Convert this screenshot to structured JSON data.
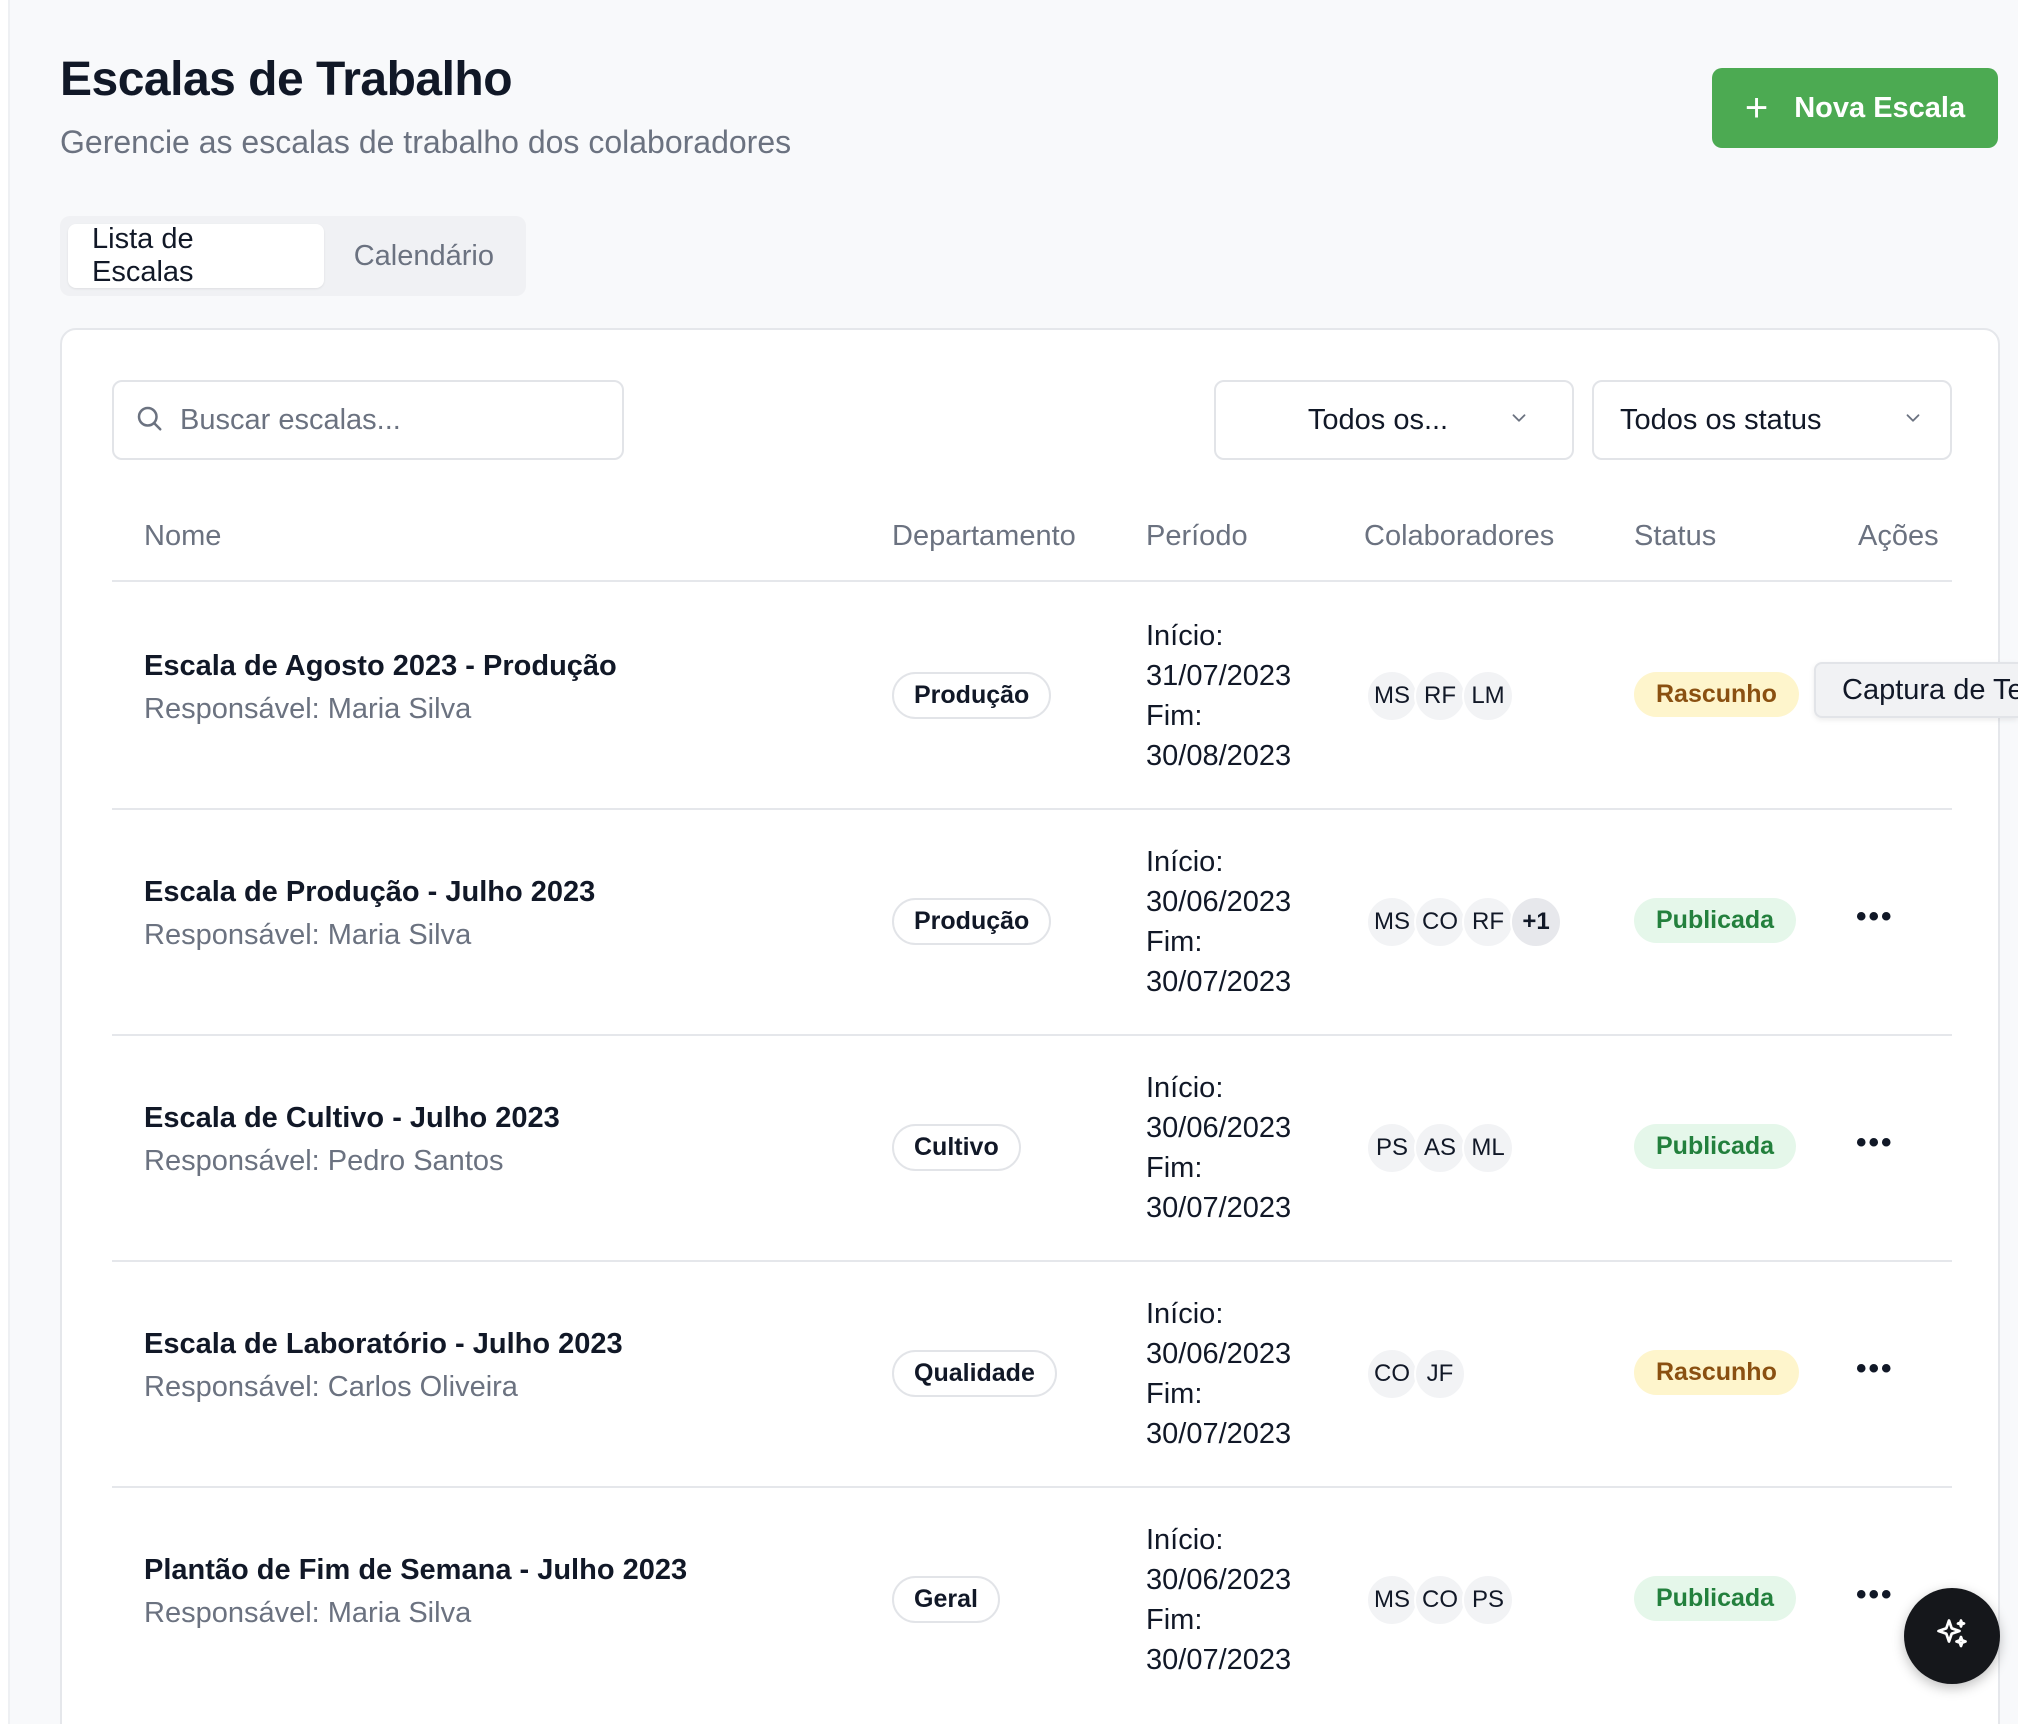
{
  "header": {
    "title": "Escalas de Trabalho",
    "subtitle": "Gerencie as escalas de trabalho dos colaboradores",
    "new_button_label": "Nova Escala",
    "new_button_color": "#4caa52"
  },
  "tabs": [
    {
      "label": "Lista de Escalas",
      "active": true
    },
    {
      "label": "Calendário",
      "active": false
    }
  ],
  "filters": {
    "search_placeholder": "Buscar escalas...",
    "search_value": "",
    "department_selected": "Todos os...",
    "status_selected": "Todos os status"
  },
  "table": {
    "headers": {
      "name": "Nome",
      "department": "Departamento",
      "period": "Período",
      "collaborators": "Colaboradores",
      "status": "Status",
      "actions": "Ações"
    },
    "rows": [
      {
        "name": "Escala de Agosto 2023 - Produção",
        "responsible": "Responsável: Maria Silva",
        "department": "Produção",
        "start_label": "Início:",
        "start": "31/07/2023",
        "end_label": "Fim:",
        "end": "30/08/2023",
        "collaborators": [
          "MS",
          "RF",
          "LM"
        ],
        "extra": "",
        "status": "Rascunho",
        "status_type": "draft"
      },
      {
        "name": "Escala de Produção - Julho 2023",
        "responsible": "Responsável: Maria Silva",
        "department": "Produção",
        "start_label": "Início:",
        "start": "30/06/2023",
        "end_label": "Fim:",
        "end": "30/07/2023",
        "collaborators": [
          "MS",
          "CO",
          "RF"
        ],
        "extra": "+1",
        "status": "Publicada",
        "status_type": "published"
      },
      {
        "name": "Escala de Cultivo - Julho 2023",
        "responsible": "Responsável: Pedro Santos",
        "department": "Cultivo",
        "start_label": "Início:",
        "start": "30/06/2023",
        "end_label": "Fim:",
        "end": "30/07/2023",
        "collaborators": [
          "PS",
          "AS",
          "ML"
        ],
        "extra": "",
        "status": "Publicada",
        "status_type": "published"
      },
      {
        "name": "Escala de Laboratório - Julho 2023",
        "responsible": "Responsável: Carlos Oliveira",
        "department": "Qualidade",
        "start_label": "Início:",
        "start": "30/06/2023",
        "end_label": "Fim:",
        "end": "30/07/2023",
        "collaborators": [
          "CO",
          "JF"
        ],
        "extra": "",
        "status": "Rascunho",
        "status_type": "draft"
      },
      {
        "name": "Plantão de Fim de Semana - Julho 2023",
        "responsible": "Responsável: Maria Silva",
        "department": "Geral",
        "start_label": "Início:",
        "start": "30/06/2023",
        "end_label": "Fim:",
        "end": "30/07/2023",
        "collaborators": [
          "MS",
          "CO",
          "PS"
        ],
        "extra": "",
        "status": "Publicada",
        "status_type": "published"
      }
    ]
  },
  "tooltip": {
    "text": "Captura de Te"
  },
  "icons": {
    "new_button": "plus-icon",
    "search": "search-icon",
    "select": "chevron-down-icon",
    "actions": "more-horizontal-icon",
    "fab": "sparkles-icon"
  },
  "colors": {
    "draft_bg": "#fef5cc",
    "draft_text": "#8a5011",
    "published_bg": "#e5f7ea",
    "published_text": "#23803d",
    "fab_bg": "#15171b"
  }
}
